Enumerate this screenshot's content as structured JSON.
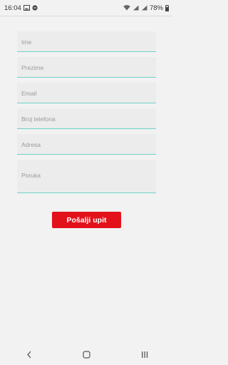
{
  "status": {
    "time": "16:04",
    "battery": "78%"
  },
  "form": {
    "fields": [
      {
        "placeholder": "Ime"
      },
      {
        "placeholder": "Prezime"
      },
      {
        "placeholder": "Email"
      },
      {
        "placeholder": "Broj telefona"
      },
      {
        "placeholder": "Adresa"
      },
      {
        "placeholder": "Poruka"
      }
    ],
    "submit_label": "Pošalji upit"
  },
  "colors": {
    "accent": "#e3121a",
    "underline": "#6fd1c8"
  },
  "navbar": {
    "back_icon": "back-icon",
    "home_icon": "home-icon",
    "recents_icon": "recents-icon"
  }
}
